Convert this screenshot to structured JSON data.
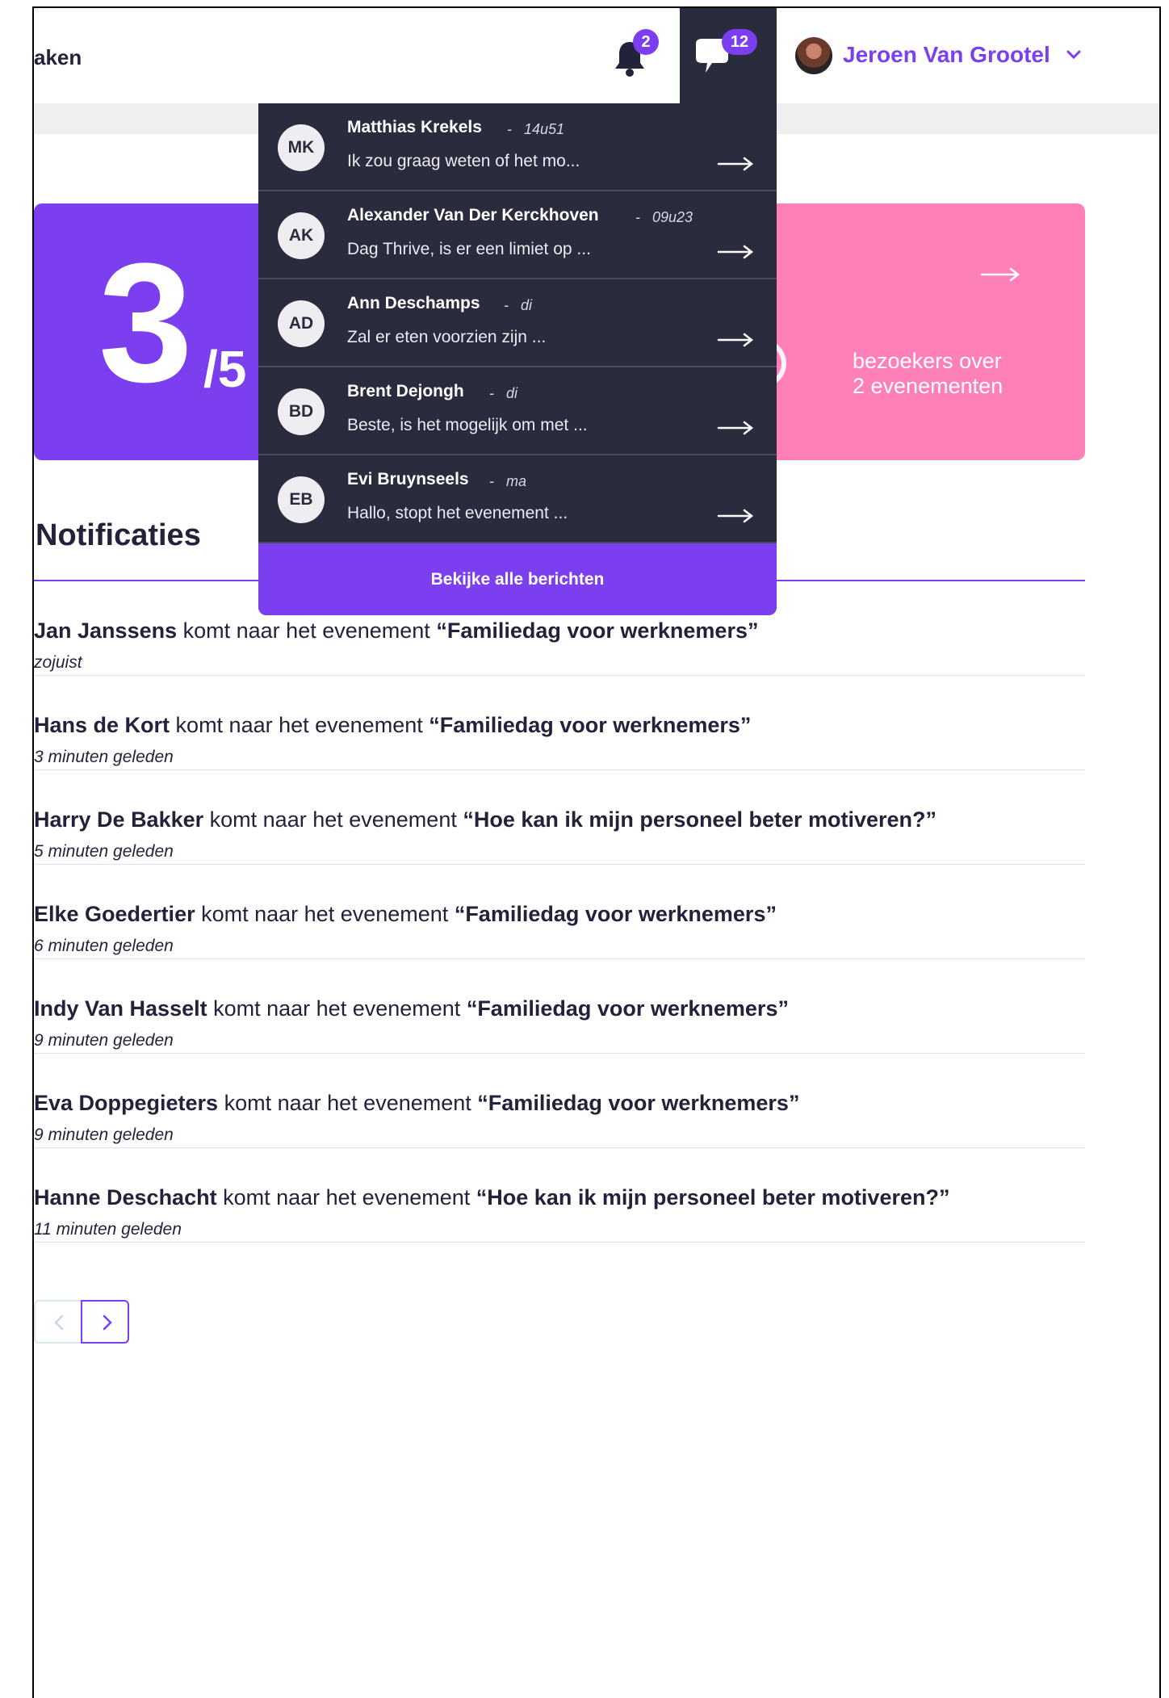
{
  "header": {
    "page_title": "aken",
    "notifications_count": "2",
    "messages_count": "12",
    "user_name": "Jeroen Van Grootel"
  },
  "stats": {
    "registrations_value": "3",
    "registrations_total": "/5",
    "visitors_label_line1": "bezoekers over",
    "visitors_label_line2": "2 evenementen"
  },
  "messages_dropdown": {
    "items": [
      {
        "initials": "MK",
        "name": "Matthias Krekels",
        "time": "14u51",
        "preview": "Ik zou graag weten of het mo..."
      },
      {
        "initials": "AK",
        "name": "Alexander Van Der Kerckhoven",
        "time": "09u23",
        "preview": "Dag Thrive, is er een limiet op ..."
      },
      {
        "initials": "AD",
        "name": "Ann Deschamps",
        "time": "di",
        "preview": "Zal er eten voorzien zijn ..."
      },
      {
        "initials": "BD",
        "name": "Brent Dejongh",
        "time": "di",
        "preview": "Beste, is het mogelijk om met ..."
      },
      {
        "initials": "EB",
        "name": "Evi Bruynseels",
        "time": "ma",
        "preview": "Hallo, stopt het evenement ..."
      }
    ],
    "separator": "-",
    "view_all_label": "Bekijke alle berichten"
  },
  "notifications": {
    "title": "Notificaties",
    "connector": "komt naar het evenement",
    "items": [
      {
        "person": "Jan Janssens",
        "event": "“Familiedag voor werknemers”",
        "time": "zojuist"
      },
      {
        "person": "Hans de Kort",
        "event": "“Familiedag voor werknemers”",
        "time": "3 minuten geleden"
      },
      {
        "person": "Harry De Bakker",
        "event": "“Hoe kan ik mijn personeel beter motiveren?”",
        "time": "5 minuten geleden"
      },
      {
        "person": "Elke Goedertier",
        "event": "“Familiedag voor werknemers”",
        "time": "6 minuten geleden"
      },
      {
        "person": "Indy Van Hasselt",
        "event": "“Familiedag voor werknemers”",
        "time": "9 minuten geleden"
      },
      {
        "person": "Eva Doppegieters",
        "event": "“Familiedag voor werknemers”",
        "time": "9 minuten geleden"
      },
      {
        "person": "Hanne Deschacht",
        "event": "“Hoe kan ik mijn personeel beter motiveren?”",
        "time": "11 minuten geleden"
      }
    ]
  },
  "colors": {
    "accent": "#7b3ff0",
    "dark": "#2a2b3d",
    "pink": "#ff7fb8"
  }
}
